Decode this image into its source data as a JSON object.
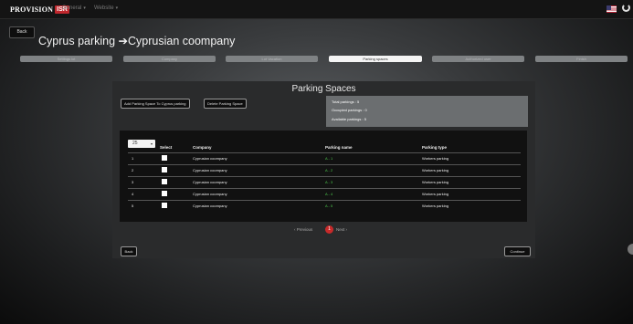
{
  "header": {
    "logo_text": "PROVISION",
    "logo_badge": "ISR",
    "nav": [
      {
        "label": "General"
      },
      {
        "label": "Website"
      }
    ]
  },
  "page": {
    "back_label": "Back",
    "title": "Cyprus parking ➔Cyprusian coompany"
  },
  "steps": [
    {
      "label": "Settings lot",
      "active": false
    },
    {
      "label": "Company",
      "active": false
    },
    {
      "label": "Lot Vacation",
      "active": false
    },
    {
      "label": "Parking spaces",
      "active": true
    },
    {
      "label": "Authorized user",
      "active": false
    },
    {
      "label": "Finish",
      "active": false
    }
  ],
  "panel": {
    "title": "Parking Spaces",
    "add_button": "Add Parking Space To Cyprus parking",
    "delete_button": "Delete Parking Space",
    "stats": {
      "total": "Total parkings : 5",
      "occupied": "Occupied parkings : 0",
      "available": "Available parkings : 5"
    },
    "per_page": "25",
    "columns": {
      "select": "Select",
      "company": "Company",
      "parking_name": "Parking name",
      "parking_type": "Parking type"
    },
    "rows": [
      {
        "num": "1",
        "company": "Cyprusian coompany",
        "name": "A - 1",
        "type": "Workers parking"
      },
      {
        "num": "2",
        "company": "Cyprusian coompany",
        "name": "A - 2",
        "type": "Workers parking"
      },
      {
        "num": "3",
        "company": "Cyprusian coompany",
        "name": "A - 3",
        "type": "Workers parking"
      },
      {
        "num": "4",
        "company": "Cyprusian coompany",
        "name": "A - 4",
        "type": "Workers parking"
      },
      {
        "num": "5",
        "company": "Cyprusian coompany",
        "name": "A - 5",
        "type": "Workers parking"
      }
    ],
    "pager": {
      "prev": "‹ Previous",
      "current": "1",
      "next": "Next ›"
    },
    "back_label": "Back",
    "continue_label": "Continue"
  },
  "colors": {
    "accent": "#c82a2a",
    "name_green": "#4ecb4e"
  }
}
